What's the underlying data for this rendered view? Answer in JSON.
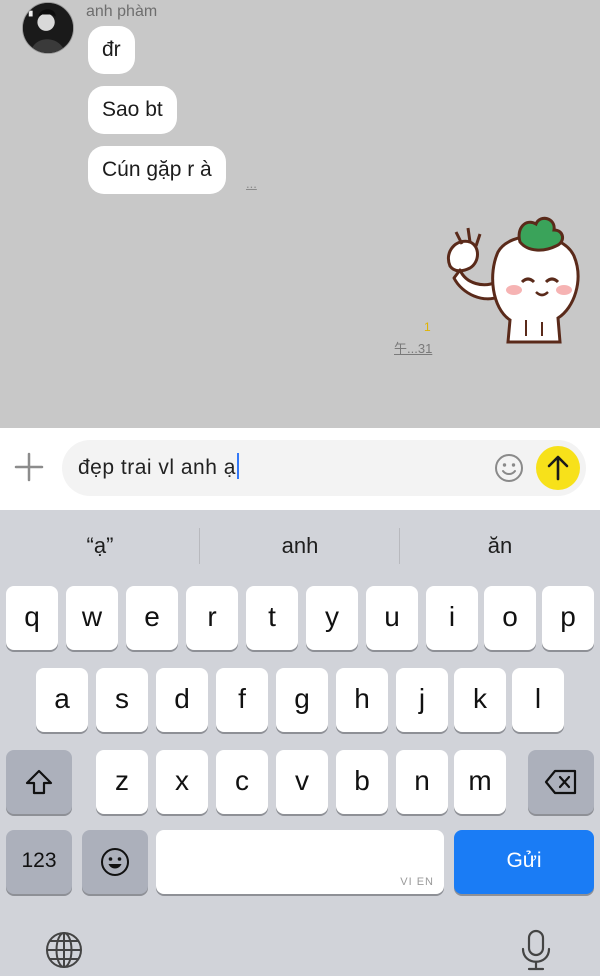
{
  "chat": {
    "sender_name": "anh phàm",
    "messages": [
      "đr",
      "Sao bt",
      "Cún gặp r à"
    ],
    "more_dots": "...",
    "read_mark": "1",
    "time": "午...31"
  },
  "input": {
    "text": "đẹp trai vl anh ạ",
    "accent_color": "#f7e11a"
  },
  "keyboard": {
    "suggestions": [
      "“ạ”",
      "anh",
      "ăn"
    ],
    "rows": [
      [
        "q",
        "w",
        "e",
        "r",
        "t",
        "y",
        "u",
        "i",
        "o",
        "p"
      ],
      [
        "a",
        "s",
        "d",
        "f",
        "g",
        "h",
        "j",
        "k",
        "l"
      ],
      [
        "z",
        "x",
        "c",
        "v",
        "b",
        "n",
        "m"
      ]
    ],
    "numbers_key": "123",
    "space_lang": "VI EN",
    "return_key": "Gửi",
    "return_color": "#1a7cf5",
    "icons": [
      "shift-icon",
      "backspace-icon",
      "emoji-icon",
      "globe-icon",
      "microphone-icon"
    ]
  }
}
